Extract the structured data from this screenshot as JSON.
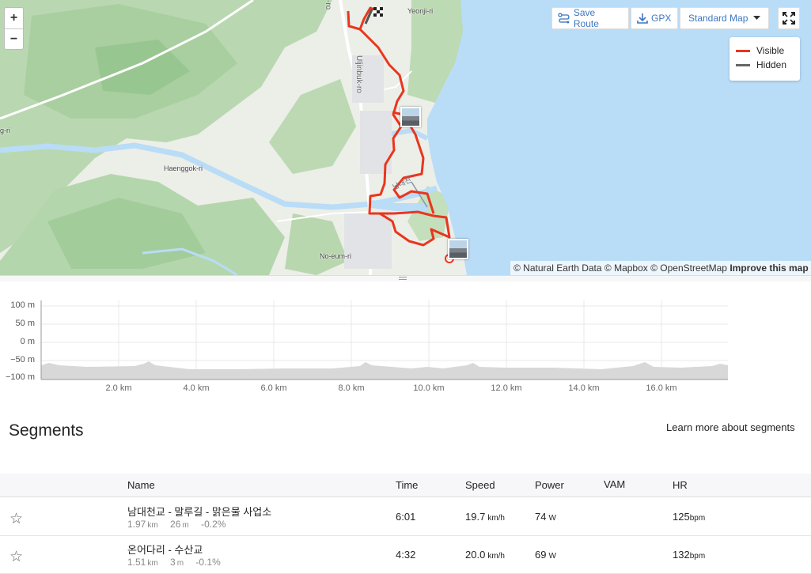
{
  "map": {
    "zoom_in": "+",
    "zoom_out": "−",
    "buttons": {
      "save_route": "Save Route",
      "gpx": "GPX",
      "standard_map": "Standard Map"
    },
    "legend": [
      {
        "label": "Visible",
        "color": "#e8361e"
      },
      {
        "label": "Hidden",
        "color": "#666666"
      }
    ],
    "place_labels": {
      "yeonji": "Yeonji-ri",
      "haenggok": "Haenggok-ri",
      "noeum": "No-eum-ri",
      "gri": "g-ri",
      "ulljinbuk": "Uljinbuk-ro",
      "ro": "-ro"
    },
    "attribution": {
      "text": "© Natural Earth Data © Mapbox © OpenStreetMap",
      "improve": "Improve this map"
    },
    "route_color": "#e8361e",
    "water_color": "#b9dcf7"
  },
  "elevation": {
    "y_labels": [
      "100 m",
      "50 m",
      "0 m",
      "−50 m",
      "−100 m"
    ],
    "x_labels": [
      "2.0 km",
      "4.0 km",
      "6.0 km",
      "8.0 km",
      "10.0 km",
      "12.0 km",
      "14.0 km",
      "16.0 km"
    ]
  },
  "segments": {
    "title": "Segments",
    "learn_more": "Learn more about segments",
    "headers": {
      "name": "Name",
      "time": "Time",
      "speed": "Speed",
      "power": "Power",
      "vam": "VAM",
      "hr": "HR"
    },
    "rows": [
      {
        "name": "남대천교 - 말루길 - 맑은물 사업소",
        "distance": "1.97",
        "distance_unit": "km",
        "elev": "26",
        "elev_unit": "m",
        "grade": "-0.2%",
        "time": "6:01",
        "speed": "19.7",
        "speed_unit": "km/h",
        "power": "74",
        "power_unit": "W",
        "vam": "",
        "hr": "125",
        "hr_unit": "bpm"
      },
      {
        "name": "온어다리 - 수산교",
        "distance": "1.51",
        "distance_unit": "km",
        "elev": "3",
        "elev_unit": "m",
        "grade": "-0.1%",
        "time": "4:32",
        "speed": "20.0",
        "speed_unit": "km/h",
        "power": "69",
        "power_unit": "W",
        "vam": "",
        "hr": "132",
        "hr_unit": "bpm"
      }
    ]
  }
}
